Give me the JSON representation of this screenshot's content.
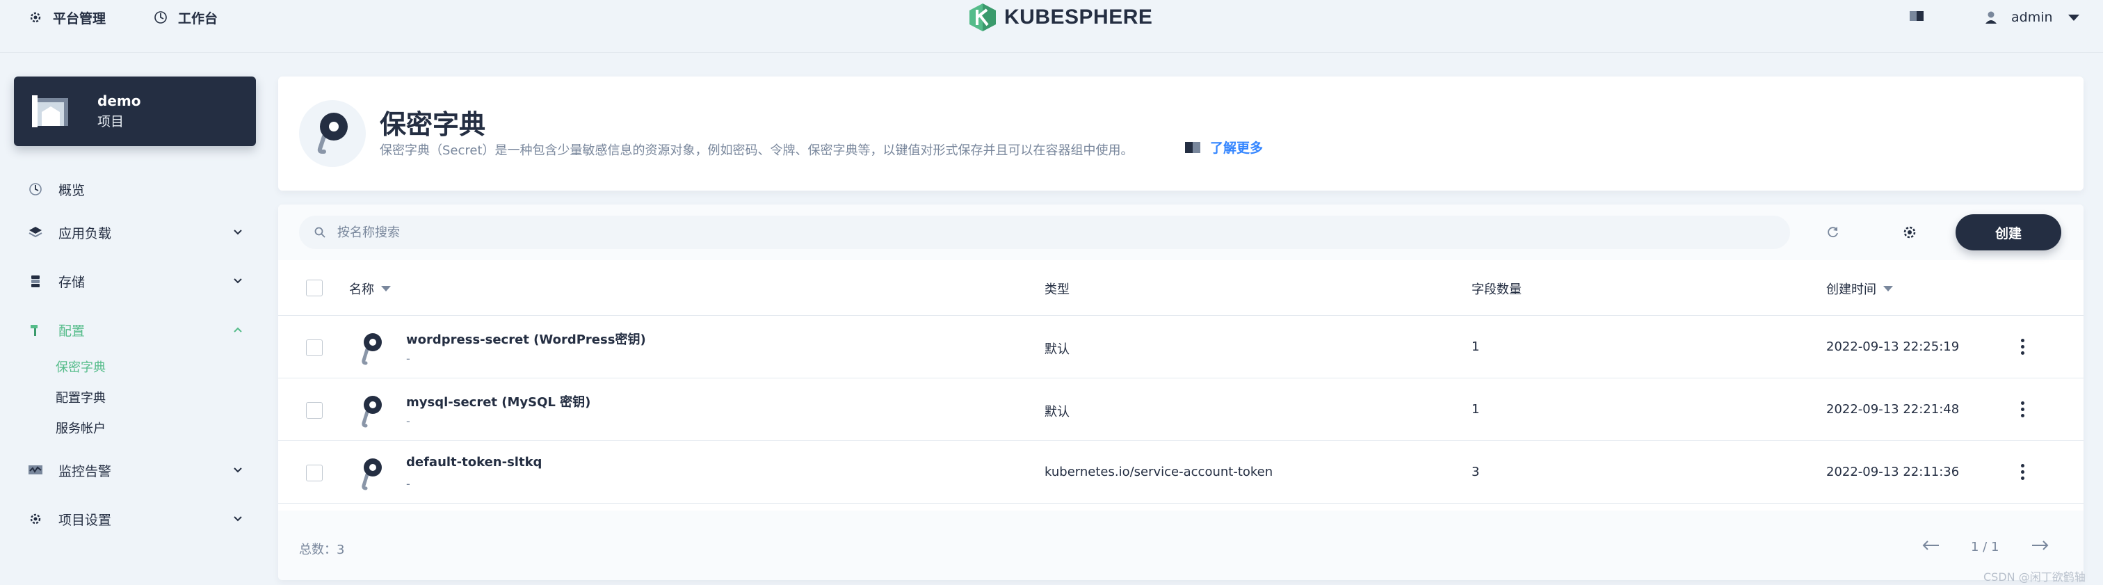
{
  "topbar": {
    "platform_label": "平台管理",
    "workbench_label": "工作台",
    "logo_text": "KUBESPHERE",
    "username": "admin"
  },
  "project": {
    "name": "demo",
    "type_label": "项目"
  },
  "sidebar": {
    "items": [
      {
        "label": "概览",
        "icon": "dashboard-icon"
      },
      {
        "label": "应用负载",
        "icon": "layers-icon"
      },
      {
        "label": "存储",
        "icon": "database-icon"
      },
      {
        "label": "配置",
        "icon": "hammer-icon",
        "active": true
      },
      {
        "label": "监控告警",
        "icon": "monitor-icon"
      },
      {
        "label": "项目设置",
        "icon": "gear-icon"
      }
    ],
    "config_sub": [
      {
        "label": "保密字典",
        "active": true
      },
      {
        "label": "配置字典"
      },
      {
        "label": "服务帐户"
      }
    ]
  },
  "header": {
    "title": "保密字典",
    "description": "保密字典（Secret）是一种包含少量敏感信息的资源对象，例如密码、令牌、保密字典等，以键值对形式保存并且可以在容器组中使用。",
    "learn_more": "了解更多"
  },
  "toolbar": {
    "search_placeholder": "按名称搜索",
    "create_label": "创建"
  },
  "table": {
    "columns": {
      "name": "名称",
      "type": "类型",
      "fields": "字段数量",
      "created": "创建时间"
    },
    "rows": [
      {
        "name": "wordpress-secret (WordPress密钥)",
        "desc": "-",
        "type": "默认",
        "fields": "1",
        "created": "2022-09-13 22:25:19"
      },
      {
        "name": "mysql-secret (MySQL 密钥)",
        "desc": "-",
        "type": "默认",
        "fields": "1",
        "created": "2022-09-13 22:21:48"
      },
      {
        "name": "default-token-sltkq",
        "desc": "-",
        "type": "kubernetes.io/service-account-token",
        "fields": "3",
        "created": "2022-09-13 22:11:36"
      }
    ]
  },
  "footer": {
    "total_label": "总数：3",
    "page": "1 / 1"
  },
  "watermark": "CSDN @闲丁欲鹤轴"
}
